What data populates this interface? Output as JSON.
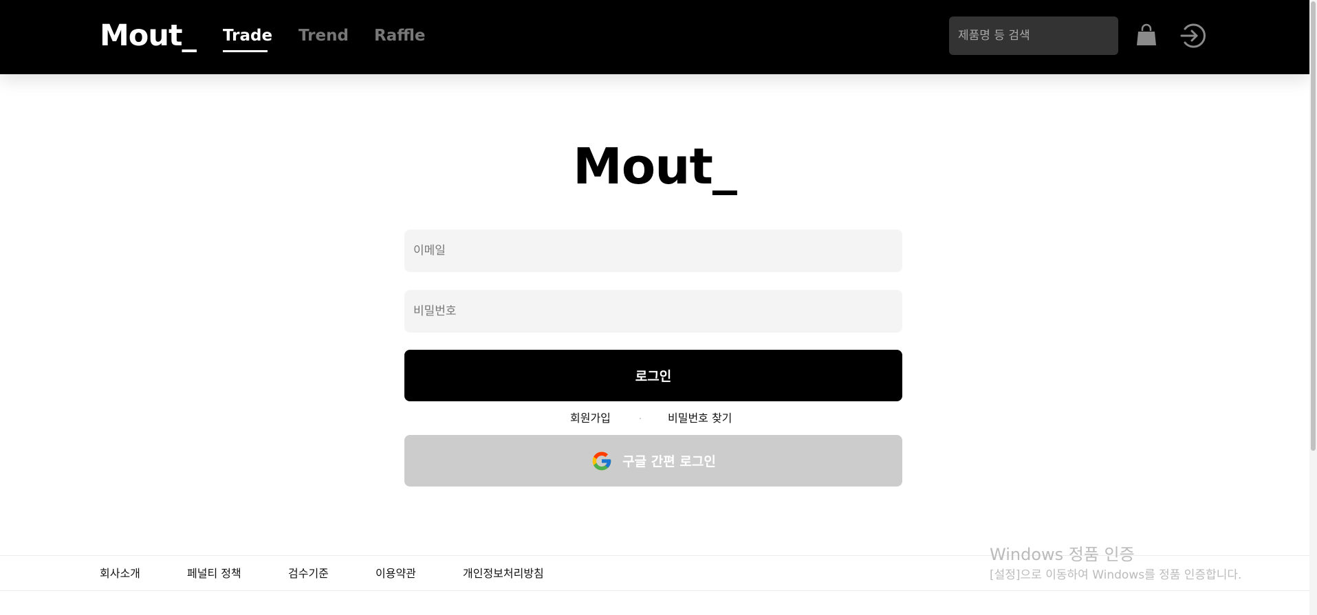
{
  "header": {
    "brand": "Mout_",
    "nav": {
      "trade": "Trade",
      "trend": "Trend",
      "raffle": "Raffle"
    },
    "search": {
      "placeholder": "제품명 등 검색"
    },
    "icons": [
      "shopping-bag-icon",
      "login-icon"
    ]
  },
  "main": {
    "logo": "Mout_",
    "email_placeholder": "이메일",
    "password_placeholder": "비밀번호",
    "login_label": "로그인",
    "signup_label": "회원가입",
    "find_password_label": "비밀번호 찾기",
    "google_login_label": "구글 간편 로그인"
  },
  "footer": {
    "links": [
      "회사소개",
      "페널티 정책",
      "검수기준",
      "이용약관",
      "개인정보처리방침"
    ]
  },
  "watermark": {
    "title": "Windows 정품 인증",
    "subtitle": "[설정]으로 이동하여 Windows를 정품 인증합니다."
  },
  "colors": {
    "header_bg": "#000000",
    "nav_active": "#ffffff",
    "nav_inactive": "#777777",
    "search_bg": "#333333",
    "field_bg": "#f4f4f4",
    "login_button_bg": "#000000",
    "google_button_bg": "#cccccc"
  }
}
